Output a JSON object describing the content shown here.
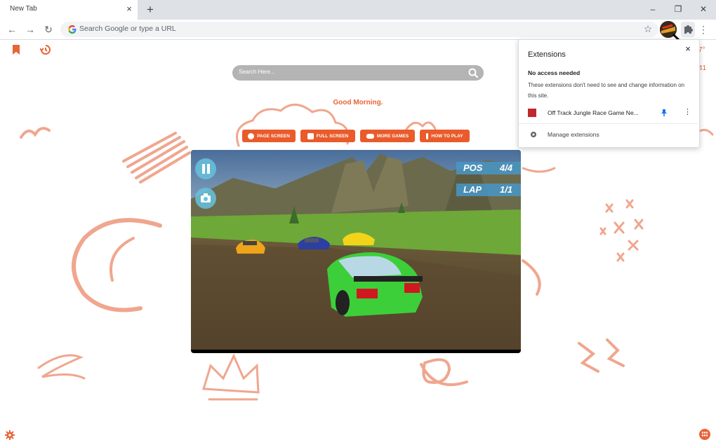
{
  "browser": {
    "tab_title": "New Tab",
    "tab_close": "×",
    "new_tab": "+",
    "window_controls": {
      "minimize": "–",
      "restore": "❐",
      "close": "✕"
    },
    "nav": {
      "back": "←",
      "forward": "→",
      "reload": "↻"
    },
    "omnibox_placeholder": "Search Google or type a URL",
    "star": "☆",
    "menu": "⋮"
  },
  "page": {
    "search_placeholder": "Search Here...",
    "greeting": "Good Morning.",
    "buttons": [
      {
        "label": "PAGE SCREEN",
        "icon": "bulb-icon"
      },
      {
        "label": "FULL SCREEN",
        "icon": "expand-icon"
      },
      {
        "label": "MORE GAMES",
        "icon": "gamepad-icon"
      },
      {
        "label": "HOW TO PLAY",
        "icon": "info-icon"
      }
    ],
    "game": {
      "pos_label": "POS",
      "pos_value": "4/4",
      "lap_label": "LAP",
      "lap_value": "1/1"
    },
    "partial_weather_top": "7°",
    "partial_weather_bottom": "41"
  },
  "extensions_popup": {
    "title": "Extensions",
    "close": "×",
    "section_title": "No access needed",
    "section_desc": "These extensions don't need to see and change information on this site.",
    "extension_name": "Off Track Jungle Race Game Ne...",
    "more": "⋮",
    "manage": "Manage extensions"
  },
  "colors": {
    "accent": "#ea5b2b",
    "doodle": "#f0a68e",
    "sky": "#5a7fa8",
    "grass": "#6ea838",
    "dirt": "#6b5638",
    "car_player": "#3ccf3a"
  }
}
